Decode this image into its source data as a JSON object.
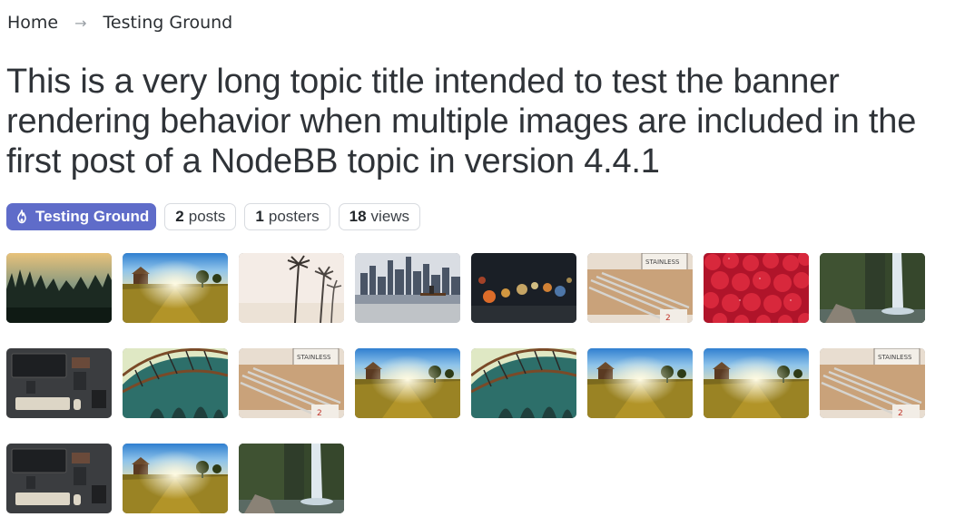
{
  "breadcrumb": {
    "home": "Home",
    "separator": "→",
    "current": "Testing Ground"
  },
  "topic": {
    "title": "This is a very long topic title intended to test the banner rendering behavior when multiple images are included in the first post of a NodeBB topic in version 4.4.1"
  },
  "stats": {
    "category": {
      "label": "Testing Ground",
      "icon": "fire-icon",
      "color": "#5f6cc9"
    },
    "posts": {
      "count": "2",
      "label": "posts"
    },
    "posters": {
      "count": "1",
      "label": "posters"
    },
    "views": {
      "count": "18",
      "label": "views"
    }
  },
  "images": [
    {
      "subject": "forest-sunrise"
    },
    {
      "subject": "sunny-field"
    },
    {
      "subject": "palm-trees"
    },
    {
      "subject": "city-skyline"
    },
    {
      "subject": "bokeh-lights"
    },
    {
      "subject": "nails-display"
    },
    {
      "subject": "strawberries"
    },
    {
      "subject": "waterfall"
    },
    {
      "subject": "desk-topdown"
    },
    {
      "subject": "bridge-arches"
    },
    {
      "subject": "nails-display"
    },
    {
      "subject": "sunny-field"
    },
    {
      "subject": "bridge-arches"
    },
    {
      "subject": "sunny-field"
    },
    {
      "subject": "sunny-field"
    },
    {
      "subject": "nails-display"
    },
    {
      "subject": "desk-topdown"
    },
    {
      "subject": "sunny-field"
    },
    {
      "subject": "waterfall"
    }
  ]
}
